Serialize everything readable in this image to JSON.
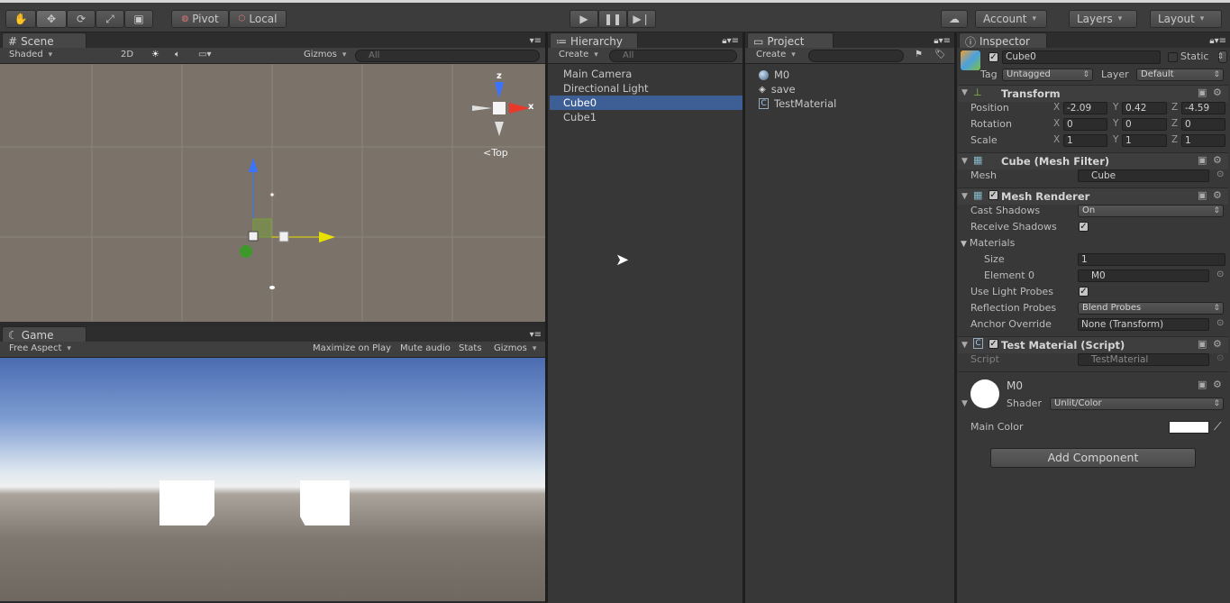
{
  "toolbar": {
    "tools": [
      "hand-tool",
      "move-tool",
      "rotate-tool",
      "scale-tool",
      "rect-tool"
    ],
    "pivot": "Pivot",
    "local": "Local",
    "account": "Account",
    "layers": "Layers",
    "layout": "Layout"
  },
  "scene": {
    "tab": "Scene",
    "shading": "Shaded",
    "mode_2d": "2D",
    "gizmos": "Gizmos",
    "search_placeholder": "All",
    "view_label": "Top",
    "axis_x": "x",
    "axis_z": "z"
  },
  "game": {
    "tab": "Game",
    "aspect": "Free Aspect",
    "maximize": "Maximize on Play",
    "mute": "Mute audio",
    "stats": "Stats",
    "gizmos": "Gizmos"
  },
  "hierarchy": {
    "tab": "Hierarchy",
    "create": "Create",
    "search_placeholder": "All",
    "items": [
      {
        "label": "Main Camera",
        "selected": false
      },
      {
        "label": "Directional Light",
        "selected": false
      },
      {
        "label": "Cube0",
        "selected": true
      },
      {
        "label": "Cube1",
        "selected": false
      }
    ]
  },
  "project": {
    "tab": "Project",
    "create": "Create",
    "items": [
      {
        "label": "M0",
        "icon": "material-sphere-icon"
      },
      {
        "label": "save",
        "icon": "unity-scene-icon"
      },
      {
        "label": "TestMaterial",
        "icon": "script-icon"
      }
    ]
  },
  "inspector": {
    "tab": "Inspector",
    "object_name": "Cube0",
    "static_label": "Static",
    "tag_label": "Tag",
    "tag_value": "Untagged",
    "layer_label": "Layer",
    "layer_value": "Default",
    "transform": {
      "title": "Transform",
      "position_label": "Position",
      "rotation_label": "Rotation",
      "scale_label": "Scale",
      "position": {
        "x": "-2.09",
        "y": "0.42",
        "z": "-4.59"
      },
      "rotation": {
        "x": "0",
        "y": "0",
        "z": "0"
      },
      "scale": {
        "x": "1",
        "y": "1",
        "z": "1"
      }
    },
    "mesh_filter": {
      "title": "Cube (Mesh Filter)",
      "mesh_label": "Mesh",
      "mesh_value": "Cube"
    },
    "mesh_renderer": {
      "title": "Mesh Renderer",
      "cast_shadows_label": "Cast Shadows",
      "cast_shadows_value": "On",
      "receive_shadows_label": "Receive Shadows",
      "materials_label": "Materials",
      "size_label": "Size",
      "size_value": "1",
      "element0_label": "Element 0",
      "element0_value": "M0",
      "light_probes_label": "Use Light Probes",
      "reflection_probes_label": "Reflection Probes",
      "reflection_probes_value": "Blend Probes",
      "anchor_override_label": "Anchor Override",
      "anchor_override_value": "None (Transform)"
    },
    "script": {
      "title": "Test Material (Script)",
      "script_label": "Script",
      "script_value": "TestMaterial"
    },
    "material": {
      "name": "M0",
      "shader_label": "Shader",
      "shader_value": "Unlit/Color",
      "main_color_label": "Main Color",
      "main_color": "#ffffff"
    },
    "add_component": "Add Component"
  }
}
